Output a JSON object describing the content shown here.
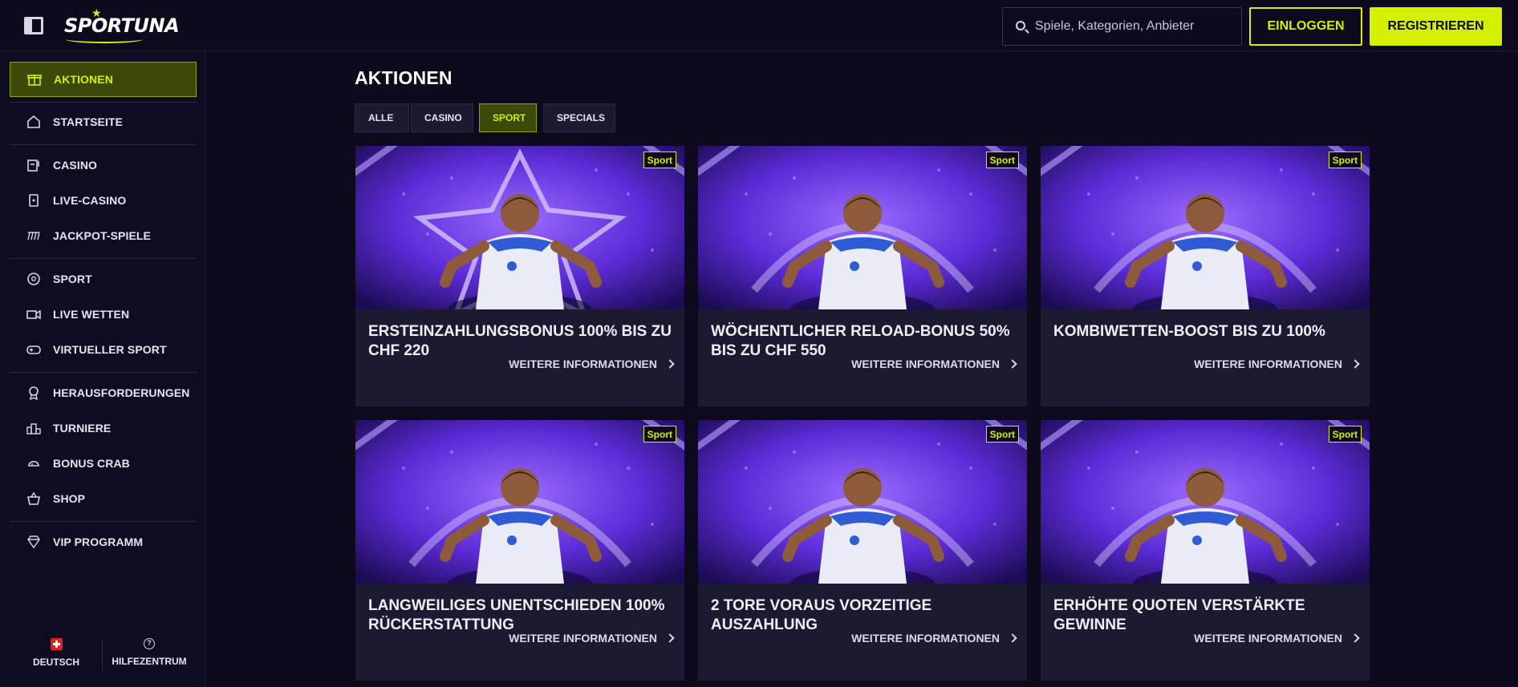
{
  "header": {
    "logo_text": "SPORTUNA",
    "search_placeholder": "Spiele, Kategorien, Anbieter",
    "login_label": "EINLOGGEN",
    "register_label": "REGISTRIEREN"
  },
  "sidebar": {
    "items": [
      {
        "label": "AKTIONEN",
        "icon": "gift-icon",
        "active": true
      },
      {
        "label": "STARTSEITE",
        "icon": "home-icon"
      },
      {
        "label": "CASINO",
        "icon": "slot-machine-icon"
      },
      {
        "label": "LIVE-CASINO",
        "icon": "playing-card-icon"
      },
      {
        "label": "JACKPOT-SPIELE",
        "icon": "jackpot-icon"
      },
      {
        "label": "SPORT",
        "icon": "soccer-ball-icon"
      },
      {
        "label": "LIVE WETTEN",
        "icon": "video-camera-icon"
      },
      {
        "label": "VIRTUELLER SPORT",
        "icon": "gamepad-icon"
      },
      {
        "label": "HERAUSFORDERUNGEN",
        "icon": "medal-icon"
      },
      {
        "label": "TURNIERE",
        "icon": "podium-icon"
      },
      {
        "label": "BONUS CRAB",
        "icon": "crab-icon"
      },
      {
        "label": "SHOP",
        "icon": "basket-icon"
      },
      {
        "label": "VIP PROGRAMM",
        "icon": "diamond-icon"
      }
    ],
    "footer": {
      "language_label": "DEUTSCH",
      "help_label": "HILFEZENTRUM"
    }
  },
  "main": {
    "title": "AKTIONEN",
    "tabs": [
      {
        "label": "ALLE"
      },
      {
        "label": "CASINO"
      },
      {
        "label": "SPORT",
        "active": true
      },
      {
        "label": "SPECIALS"
      }
    ],
    "cards": [
      {
        "badge": "Sport",
        "title": "ERSTEINZAHLUNGSBONUS 100% BIS ZU CHF 220",
        "link": "WEITERE INFORMATIONEN"
      },
      {
        "badge": "Sport",
        "title": "WÖCHENTLICHER RELOAD-BONUS 50% BIS ZU CHF 550",
        "link": "WEITERE INFORMATIONEN"
      },
      {
        "badge": "Sport",
        "title": "KOMBIWETTEN-BOOST BIS ZU 100%",
        "link": "WEITERE INFORMATIONEN"
      },
      {
        "badge": "Sport",
        "title": "LANGWEILIGES UNENTSCHIEDEN 100% RÜCKERSTATTUNG",
        "link": "WEITERE INFORMATIONEN"
      },
      {
        "badge": "Sport",
        "title": "2 TORE VORAUS VORZEITIGE AUSZAHLUNG",
        "link": "WEITERE INFORMATIONEN"
      },
      {
        "badge": "Sport",
        "title": "ERHÖHTE QUOTEN VERSTÄRKTE GEWINNE",
        "link": "WEITERE INFORMATIONEN"
      }
    ]
  },
  "colors": {
    "background": "#0c0a1c",
    "accent": "#d4f000",
    "card": "#1c1a30",
    "promo_purple": "#5b2bd6"
  }
}
